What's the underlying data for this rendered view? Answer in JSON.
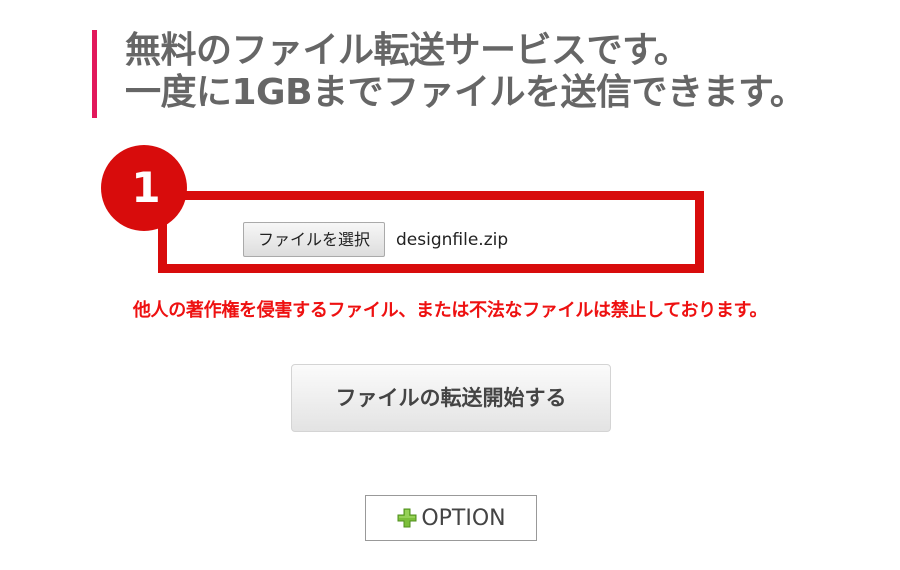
{
  "headline": {
    "line1": "無料のファイル転送サービスです。",
    "line2": "一度に1GBまでファイルを送信できます。"
  },
  "upload": {
    "step_number": "1",
    "choose_file_label": "ファイルを選択",
    "file_name": "designfile.zip"
  },
  "warning": "他人の著作権を侵害するファイル、または不法なファイルは禁止しております。",
  "start_button_label": "ファイルの転送開始する",
  "option": {
    "icon": "plus-icon",
    "label": "OPTION"
  },
  "colors": {
    "accent_red": "#d80c0c",
    "headline_bar": "#e2185b",
    "warning_text": "#ee1111",
    "plus_green": "#7cbf3a"
  }
}
